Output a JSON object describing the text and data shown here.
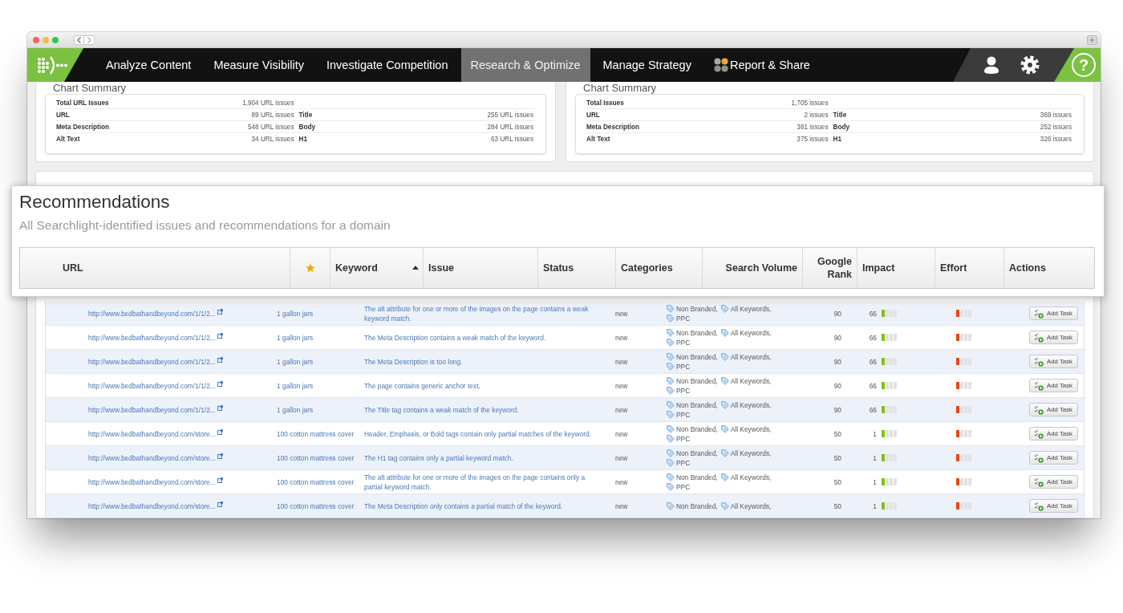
{
  "nav": {
    "items": [
      {
        "label": "Analyze Content",
        "kind": "plain",
        "selected": false
      },
      {
        "label": "Measure Visibility",
        "kind": "plain",
        "selected": false
      },
      {
        "label": "Investigate Competition",
        "kind": "plain",
        "selected": false
      },
      {
        "label": "Research & Optimize",
        "kind": "plain",
        "selected": true
      },
      {
        "label": "Manage Strategy",
        "kind": "plain",
        "selected": false
      },
      {
        "label": "Report & Share",
        "kind": "dots",
        "selected": false
      }
    ],
    "help_label": "?"
  },
  "chart_summaries": [
    {
      "title": "Chart Summary",
      "rows": [
        {
          "cells": [
            {
              "label": "Total URL Issues",
              "value": "1,904 URL issues"
            }
          ]
        },
        {
          "cells": [
            {
              "label": "URL",
              "value": "89 URL issues"
            },
            {
              "label": "Title",
              "value": "255 URL issues"
            }
          ]
        },
        {
          "cells": [
            {
              "label": "Meta Description",
              "value": "548 URL issues"
            },
            {
              "label": "Body",
              "value": "284 URL issues"
            }
          ]
        },
        {
          "cells": [
            {
              "label": "Alt Text",
              "value": "34 URL issues"
            },
            {
              "label": "H1",
              "value": "63 URL issues"
            }
          ]
        }
      ]
    },
    {
      "title": "Chart Summary",
      "rows": [
        {
          "cells": [
            {
              "label": "Total Issues",
              "value": "1,705 issues"
            }
          ]
        },
        {
          "cells": [
            {
              "label": "URL",
              "value": "2 issues"
            },
            {
              "label": "Title",
              "value": "369 issues"
            }
          ]
        },
        {
          "cells": [
            {
              "label": "Meta Description",
              "value": "381 issues"
            },
            {
              "label": "Body",
              "value": "252 issues"
            }
          ]
        },
        {
          "cells": [
            {
              "label": "Alt Text",
              "value": "375 issues"
            },
            {
              "label": "H1",
              "value": "326 issues"
            }
          ]
        }
      ]
    }
  ],
  "recommendations": {
    "title": "Recommendations",
    "subtitle": "All Searchlight-identified issues and recommendations for a domain",
    "columns": [
      {
        "kind": "text",
        "label": "URL",
        "sorted": false
      },
      {
        "kind": "star",
        "sorted": false
      },
      {
        "kind": "text",
        "label": "Keyword",
        "sorted": true
      },
      {
        "kind": "text",
        "label": "Issue",
        "sorted": false
      },
      {
        "kind": "text",
        "label": "Status",
        "sorted": false
      },
      {
        "kind": "text",
        "label": "Categories",
        "sorted": false
      },
      {
        "kind": "number",
        "label": "Search Volume",
        "sorted": false
      },
      {
        "kind": "number",
        "label": "Google Rank",
        "sorted": false
      },
      {
        "kind": "text",
        "label": "Impact",
        "sorted": false
      },
      {
        "kind": "text",
        "label": "Effort",
        "sorted": false
      },
      {
        "kind": "text",
        "label": "Actions",
        "sorted": false
      }
    ],
    "rows": [
      {
        "url": "http://www.bedbathandbeyond.com/1/1/2...",
        "keyword": "1 gallon jars",
        "issue": "The alt attribute for one or more of the images on the page contains a weak keyword match.",
        "status": "new",
        "categories": [
          "Non Branded,",
          "All Keywords,",
          "PPC"
        ],
        "google_rank": "90",
        "impact": {
          "value": "66",
          "level": 0.25
        },
        "effort": {
          "level": 0.25
        },
        "action": "Add Task"
      },
      {
        "url": "http://www.bedbathandbeyond.com/1/1/2...",
        "keyword": "1 gallon jars",
        "issue": "The Meta Description contains a weak match of the keyword.",
        "status": "new",
        "categories": [
          "Non Branded,",
          "All Keywords,",
          "PPC"
        ],
        "google_rank": "90",
        "impact": {
          "value": "66",
          "level": 0.25
        },
        "effort": {
          "level": 0.25
        },
        "action": "Add Task"
      },
      {
        "url": "http://www.bedbathandbeyond.com/1/1/2...",
        "keyword": "1 gallon jars",
        "issue": "The Meta Description is too long.",
        "status": "new",
        "categories": [
          "Non Branded,",
          "All Keywords,",
          "PPC"
        ],
        "google_rank": "90",
        "impact": {
          "value": "66",
          "level": 0.25
        },
        "effort": {
          "level": 0.25
        },
        "action": "Add Task"
      },
      {
        "url": "http://www.bedbathandbeyond.com/1/1/2...",
        "keyword": "1 gallon jars",
        "issue": "The page contains generic anchor text.",
        "status": "new",
        "categories": [
          "Non Branded,",
          "All Keywords,",
          "PPC"
        ],
        "google_rank": "90",
        "impact": {
          "value": "66",
          "level": 0.25
        },
        "effort": {
          "level": 0.25
        },
        "action": "Add Task"
      },
      {
        "url": "http://www.bedbathandbeyond.com/1/1/2...",
        "keyword": "1 gallon jars",
        "issue": "The Title tag contains a weak match of the keyword.",
        "status": "new",
        "categories": [
          "Non Branded,",
          "All Keywords,",
          "PPC"
        ],
        "google_rank": "90",
        "impact": {
          "value": "66",
          "level": 0.25
        },
        "effort": {
          "level": 0.25
        },
        "action": "Add Task"
      },
      {
        "url": "http://www.bedbathandbeyond.com/store...",
        "keyword": "100 cotton mattress cover",
        "issue": "Header, Emphasis, or Bold tags contain only partial matches of the keyword.",
        "status": "new",
        "categories": [
          "Non Branded,",
          "All Keywords,",
          "PPC"
        ],
        "google_rank": "50",
        "impact": {
          "value": "1",
          "level": 0.25
        },
        "effort": {
          "level": 0.25
        },
        "action": "Add Task"
      },
      {
        "url": "http://www.bedbathandbeyond.com/store...",
        "keyword": "100 cotton mattress cover",
        "issue": "The H1 tag contains only a partial keyword match.",
        "status": "new",
        "categories": [
          "Non Branded,",
          "All Keywords,",
          "PPC"
        ],
        "google_rank": "50",
        "impact": {
          "value": "1",
          "level": 0.25
        },
        "effort": {
          "level": 0.25
        },
        "action": "Add Task"
      },
      {
        "url": "http://www.bedbathandbeyond.com/store...",
        "keyword": "100 cotton mattress cover",
        "issue": "The alt attribute for one or more of the images on the page contains only a partial keyword match.",
        "status": "new",
        "categories": [
          "Non Branded,",
          "All Keywords,",
          "PPC"
        ],
        "google_rank": "50",
        "impact": {
          "value": "1",
          "level": 0.25
        },
        "effort": {
          "level": 0.25
        },
        "action": "Add Task"
      },
      {
        "url": "http://www.bedbathandbeyond.com/store...",
        "keyword": "100 cotton mattress cover",
        "issue": "The Meta Description only contains a partial match of the keyword.",
        "status": "new",
        "categories": [
          "Non Branded,",
          "All Keywords,"
        ],
        "google_rank": "50",
        "impact": {
          "value": "1",
          "level": 0.25
        },
        "effort": {
          "level": 0.25
        },
        "action": "Add Task"
      }
    ]
  }
}
